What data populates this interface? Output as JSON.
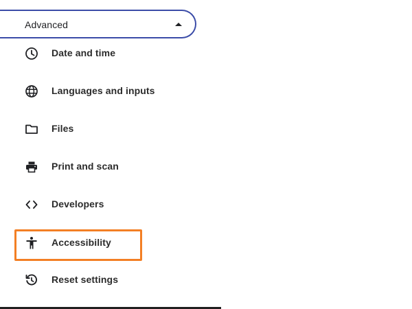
{
  "advanced": {
    "label": "Advanced",
    "icon": "caret-up-icon"
  },
  "menu": {
    "items": [
      {
        "label": "Date and time",
        "icon": "clock-icon"
      },
      {
        "label": "Languages and inputs",
        "icon": "globe-icon"
      },
      {
        "label": "Files",
        "icon": "folder-icon"
      },
      {
        "label": "Print and scan",
        "icon": "printer-icon"
      },
      {
        "label": "Developers",
        "icon": "code-icon"
      },
      {
        "label": "Accessibility",
        "icon": "accessibility-icon"
      },
      {
        "label": "Reset settings",
        "icon": "reset-icon"
      }
    ]
  },
  "colors": {
    "highlight": "#f37f24",
    "toggle_border": "#3b4ca8",
    "text": "#2b2b2b"
  }
}
